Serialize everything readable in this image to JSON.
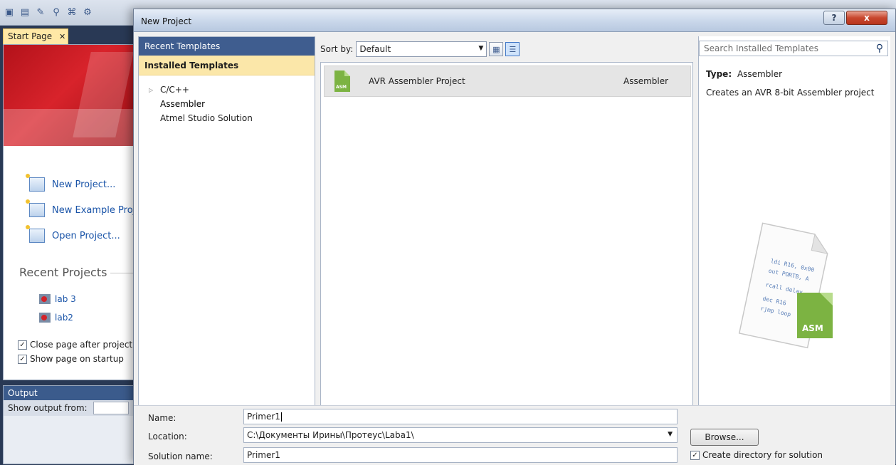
{
  "ide": {
    "start_tab": "Start Page",
    "links": [
      "New Project...",
      "New Example Proj",
      "Open Project..."
    ],
    "recent_title": "Recent Projects",
    "recent_items": [
      "lab 3",
      "lab2"
    ],
    "close_page_label": "Close page after project",
    "show_page_label": "Show page on startup",
    "output_title": "Output",
    "output_from_label": "Show output from:"
  },
  "dialog": {
    "title": "New Project",
    "help_icon": "?",
    "close_icon": "x",
    "recent_templates": "Recent Templates",
    "installed_templates": "Installed Templates",
    "tree": [
      {
        "label": "C/C++",
        "expandable": true
      },
      {
        "label": "Assembler",
        "expandable": false
      },
      {
        "label": "Atmel Studio Solution",
        "expandable": false
      }
    ],
    "sort_label": "Sort by:",
    "sort_value": "Default",
    "templates": [
      {
        "name": "AVR Assembler Project",
        "lang": "Assembler",
        "icon_text": "ASM"
      }
    ],
    "search_placeholder": "Search Installed Templates",
    "type_label": "Type:",
    "type_value": "Assembler",
    "description": "Creates an AVR 8-bit Assembler project",
    "preview_code": [
      "ldi R16, 0x00",
      "out PORTB, A",
      "rcall delay",
      "dec R16",
      "rjmp loop"
    ],
    "preview_badge": "ASM",
    "name_label": "Name:",
    "name_value": "Primer1",
    "location_label": "Location:",
    "location_value": "C:\\Документы Ирины\\Протеус\\Laba1\\",
    "solution_label": "Solution name:",
    "solution_value": "Primer1",
    "browse_label": "Browse...",
    "create_dir_label": "Create directory for solution",
    "colors": {
      "accent": "#3f5d8f",
      "installed_bg": "#fbe7a9",
      "asm_green": "#7cb342",
      "close_red": "#c8472e"
    }
  }
}
